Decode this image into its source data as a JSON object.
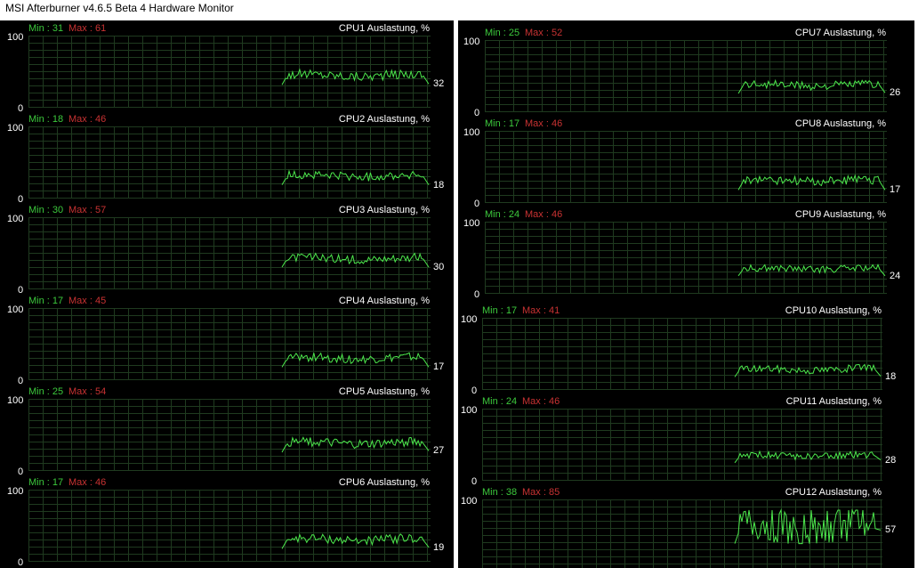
{
  "window": {
    "title": "MSI Afterburner v4.6.5 Beta 4 Hardware Monitor"
  },
  "colors": {
    "background": "#000000",
    "grid": "#1f3a1f",
    "line": "#4ce84c",
    "min_text": "#3cc83c",
    "max_text": "#c83232"
  },
  "graphs": [
    {
      "title": "CPU1 Auslastung, %",
      "min_label": "Min : 31",
      "max_label": "Max : 61",
      "axis_max": "100",
      "axis_min": "0",
      "current": "32",
      "min": 31,
      "max": 61,
      "last": 32
    },
    {
      "title": "CPU2 Auslastung, %",
      "min_label": "Min : 18",
      "max_label": "Max : 46",
      "axis_max": "100",
      "axis_min": "0",
      "current": "18",
      "min": 18,
      "max": 46,
      "last": 18
    },
    {
      "title": "CPU3 Auslastung, %",
      "min_label": "Min : 30",
      "max_label": "Max : 57",
      "axis_max": "100",
      "axis_min": "0",
      "current": "30",
      "min": 30,
      "max": 57,
      "last": 30
    },
    {
      "title": "CPU4 Auslastung, %",
      "min_label": "Min : 17",
      "max_label": "Max : 45",
      "axis_max": "100",
      "axis_min": "0",
      "current": "17",
      "min": 17,
      "max": 45,
      "last": 17
    },
    {
      "title": "CPU5 Auslastung, %",
      "min_label": "Min : 25",
      "max_label": "Max : 54",
      "axis_max": "100",
      "axis_min": "0",
      "current": "27",
      "min": 25,
      "max": 54,
      "last": 27
    },
    {
      "title": "CPU6 Auslastung, %",
      "min_label": "Min : 17",
      "max_label": "Max : 46",
      "axis_max": "100",
      "axis_min": "0",
      "current": "19",
      "min": 17,
      "max": 46,
      "last": 19
    },
    {
      "title": "CPU7 Auslastung, %",
      "min_label": "Min : 25",
      "max_label": "Max : 52",
      "axis_max": "100",
      "axis_min": "0",
      "current": "26",
      "min": 25,
      "max": 52,
      "last": 26
    },
    {
      "title": "CPU8 Auslastung, %",
      "min_label": "Min : 17",
      "max_label": "Max : 46",
      "axis_max": "100",
      "axis_min": "0",
      "current": "17",
      "min": 17,
      "max": 46,
      "last": 17
    },
    {
      "title": "CPU9 Auslastung, %",
      "min_label": "Min : 24",
      "max_label": "Max : 46",
      "axis_max": "100",
      "axis_min": "0",
      "current": "24",
      "min": 24,
      "max": 46,
      "last": 24
    },
    {
      "title": "CPU10 Auslastung, %",
      "min_label": "Min : 17",
      "max_label": "Max : 41",
      "axis_max": "100",
      "axis_min": "0",
      "current": "18",
      "min": 17,
      "max": 41,
      "last": 18
    },
    {
      "title": "CPU11 Auslastung, %",
      "min_label": "Min : 24",
      "max_label": "Max : 46",
      "axis_max": "100",
      "axis_min": "0",
      "current": "28",
      "min": 24,
      "max": 46,
      "last": 28
    },
    {
      "title": "CPU12 Auslastung, %",
      "min_label": "Min : 38",
      "max_label": "Max : 85",
      "axis_max": "100",
      "axis_min": "0",
      "current": "57",
      "min": 38,
      "max": 85,
      "last": 57
    }
  ]
}
